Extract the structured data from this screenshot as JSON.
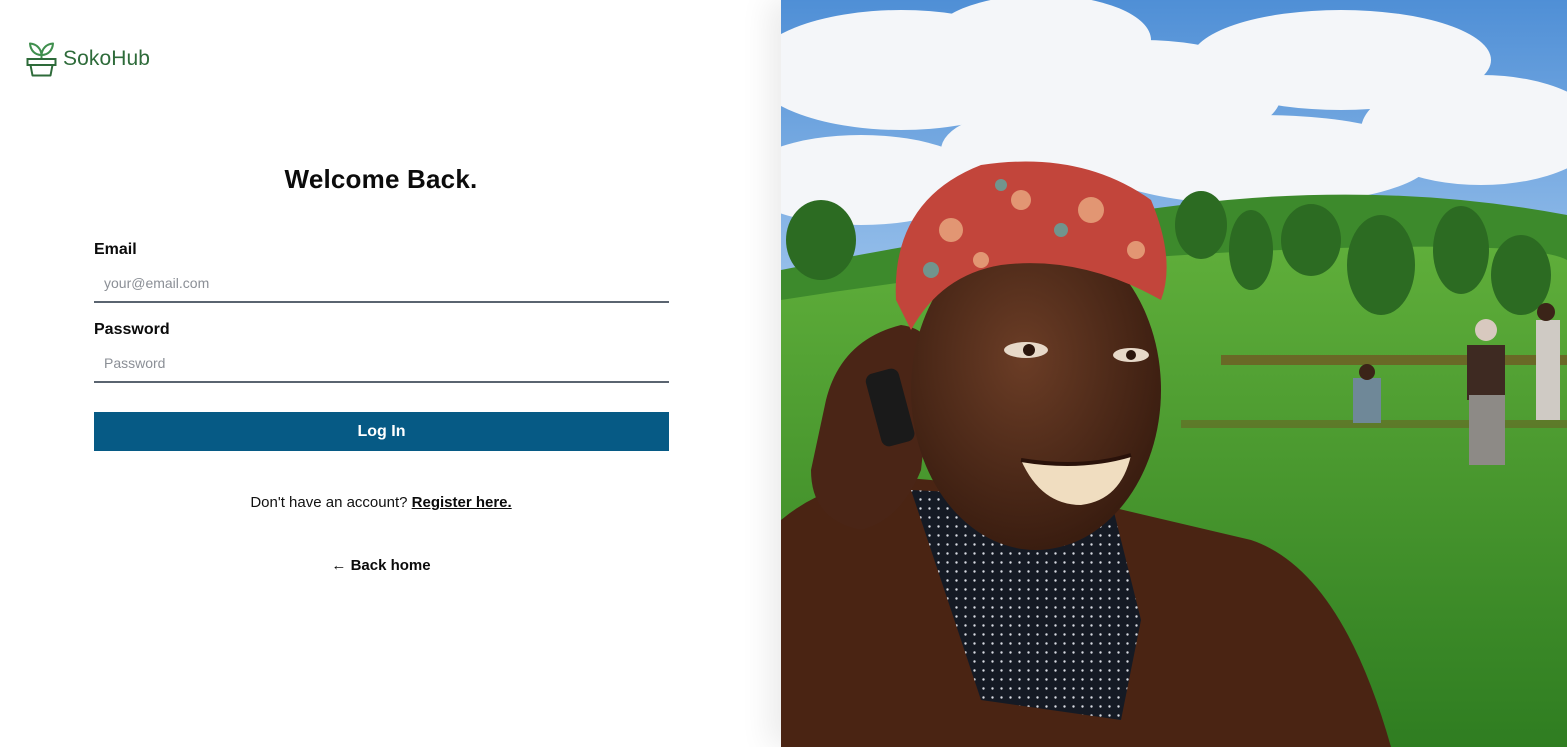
{
  "brand": {
    "name": "SokoHub",
    "icon": "plant-pot-icon",
    "color": "#2e6b3a"
  },
  "heading": "Welcome Back.",
  "form": {
    "email_label": "Email",
    "email_placeholder": "your@email.com",
    "email_value": "",
    "password_label": "Password",
    "password_placeholder": "Password",
    "password_value": "",
    "submit_label": "Log In"
  },
  "register": {
    "prompt": "Don't have an account?",
    "link_label": "Register here."
  },
  "back_home": {
    "arrow": "←",
    "label": "Back home"
  },
  "colors": {
    "primary_button": "#065a85",
    "input_border": "#5a6470"
  }
}
